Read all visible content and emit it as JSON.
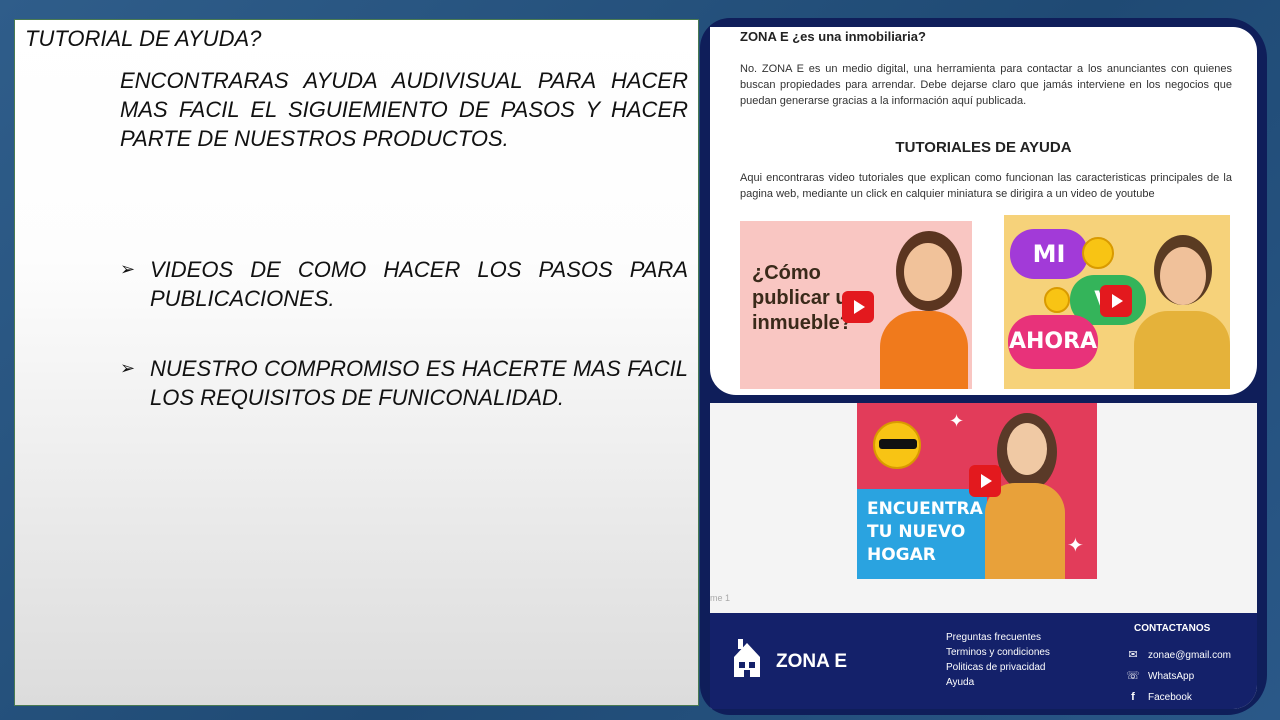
{
  "slide": {
    "title": "TUTORIAL DE AYUDA?",
    "intro": "ENCONTRARAS AYUDA AUDIVISUAL PARA HACER MAS FACIL EL SIGUIEMIENTO DE PASOS Y HACER PARTE DE NUESTROS PRODUCTOS.",
    "bullets": [
      "VIDEOS DE COMO HACER LOS PASOS PARA PUBLICACIONES.",
      "NUESTRO COMPROMISO ES HACERTE MAS FACIL LOS REQUISITOS DE FUNICONALIDAD."
    ],
    "bullet_icon": "arrow-bullet-icon"
  },
  "website": {
    "heading": "ZONA E ¿es una inmobiliaria?",
    "intro": "No. ZONA E es un medio digital, una herramienta para contactar a los anunciantes con quienes buscan propiedades para arrendar. Debe dejarse claro que jamás interviene en los negocios que puedan generarse gracias a la información aquí publicada.",
    "tutorials_title": "TUTORIALES DE AYUDA",
    "tutorials_text": "Aqui encontraras video tutoriales que explican como funcionan las caracteristicas principales de la pagina web, mediante un click en calquier miniatura se dirigira a un video de youtube",
    "videos": [
      {
        "text": "¿Cómo publicar un inmueble?"
      },
      {
        "bubbles": [
          "MI",
          "VI",
          "AHORA"
        ]
      },
      {
        "text": "ENCUENTRA TU NUEVO HOGAR"
      }
    ],
    "page_note": "me 1",
    "footer": {
      "brand": "ZONA E",
      "links": [
        "Preguntas frecuentes",
        "Terminos y condiciones",
        "Politicas de privacidad",
        "Ayuda"
      ],
      "contact_title": "CONTACTANOS",
      "contacts": [
        {
          "icon": "mail-icon",
          "label": "zonae@gmail.com"
        },
        {
          "icon": "whatsapp-icon",
          "label": "WhatsApp"
        },
        {
          "icon": "facebook-icon",
          "label": "Facebook"
        }
      ]
    }
  },
  "colors": {
    "background": "#2f5d8a",
    "footer": "#14216a",
    "play_button": "#e3191e"
  }
}
